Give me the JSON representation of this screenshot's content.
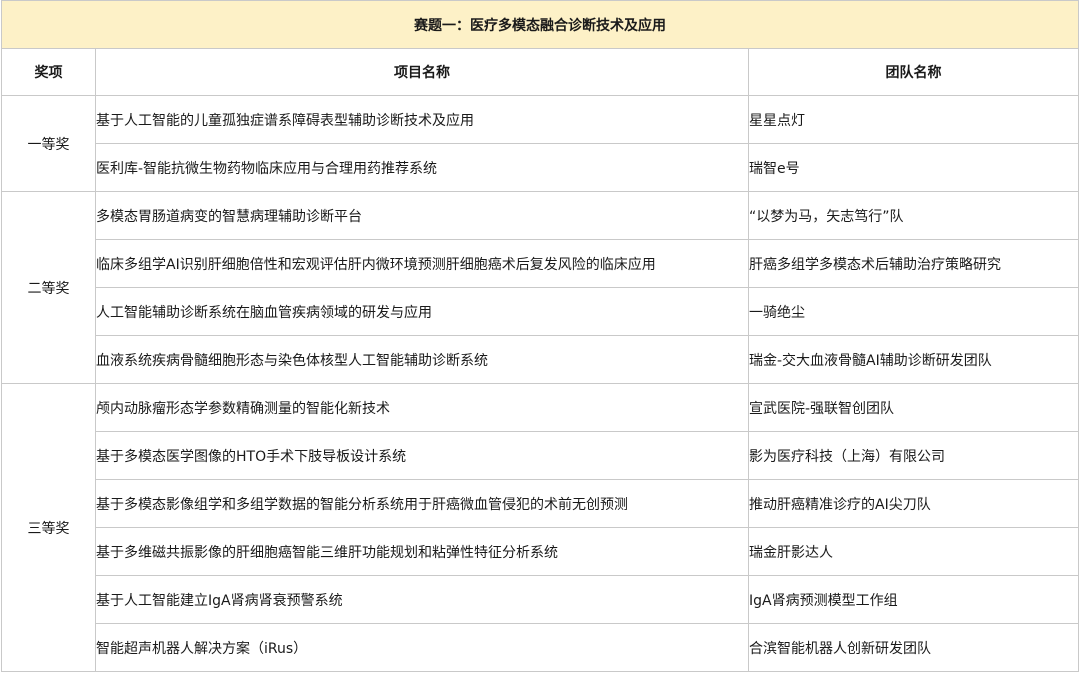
{
  "title": "赛题一：医疗多模态融合诊断技术及应用",
  "headers": {
    "award": "奖项",
    "project": "项目名称",
    "team": "团队名称"
  },
  "groups": [
    {
      "award": "一等奖",
      "rows": [
        {
          "project": "基于人工智能的儿童孤独症谱系障碍表型辅助诊断技术及应用",
          "team": "星星点灯"
        },
        {
          "project": "医利库-智能抗微生物药物临床应用与合理用药推荐系统",
          "team": "瑞智e号"
        }
      ]
    },
    {
      "award": "二等奖",
      "rows": [
        {
          "project": "多模态胃肠道病变的智慧病理辅助诊断平台",
          "team": "“以梦为马，矢志笃行”队"
        },
        {
          "project": "临床多组学AI识别肝细胞倍性和宏观评估肝内微环境预测肝细胞癌术后复发风险的临床应用",
          "team": "肝癌多组学多模态术后辅助治疗策略研究"
        },
        {
          "project": "人工智能辅助诊断系统在脑血管疾病领域的研发与应用",
          "team": "一骑绝尘"
        },
        {
          "project": "血液系统疾病骨髓细胞形态与染色体核型人工智能辅助诊断系统",
          "team": "瑞金-交大血液骨髓AI辅助诊断研发团队"
        }
      ]
    },
    {
      "award": "三等奖",
      "rows": [
        {
          "project": "颅内动脉瘤形态学参数精确测量的智能化新技术",
          "team": "宣武医院-强联智创团队"
        },
        {
          "project": "基于多模态医学图像的HTO手术下肢导板设计系统",
          "team": "影为医疗科技（上海）有限公司"
        },
        {
          "project": "基于多模态影像组学和多组学数据的智能分析系统用于肝癌微血管侵犯的术前无创预测",
          "team": "推动肝癌精准诊疗的AI尖刀队"
        },
        {
          "project": "基于多维磁共振影像的肝细胞癌智能三维肝功能规划和粘弹性特征分析系统",
          "team": "瑞金肝影达人"
        },
        {
          "project": "基于人工智能建立IgA肾病肾衰预警系统",
          "team": "IgA肾病预测模型工作组"
        },
        {
          "project": "智能超声机器人解决方案（iRus）",
          "team": "合滨智能机器人创新研发团队"
        }
      ]
    }
  ]
}
